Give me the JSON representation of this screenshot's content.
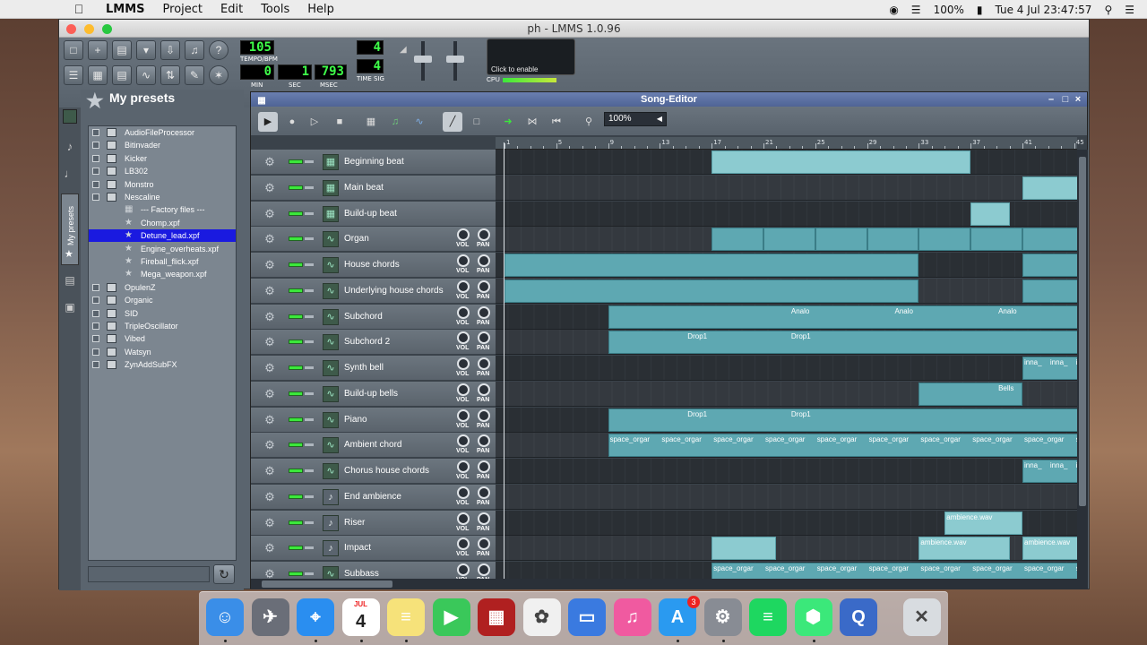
{
  "menubar": {
    "apple": "",
    "app_name": "LMMS",
    "items": [
      "Project",
      "Edit",
      "Tools",
      "Help"
    ],
    "battery": "100%",
    "datetime": "Tue 4 Jul  23:47:57"
  },
  "window": {
    "title": "ph - LMMS 1.0.96"
  },
  "transport": {
    "tempo": "105",
    "tempo_label": "TEMPO/BPM",
    "min": "0",
    "sec": "1",
    "msec": "793",
    "min_label": "MIN",
    "sec_label": "SEC",
    "msec_label": "MSEC",
    "timesig_num": "4",
    "timesig_den": "4",
    "timesig_label": "TIME SIG",
    "cpu_hint": "Click to enable",
    "cpu_label": "CPU"
  },
  "sidebar": {
    "title": "My presets",
    "tab_label": "My presets",
    "tree": [
      {
        "label": "AudioFileProcessor",
        "level": 0
      },
      {
        "label": "Bitinvader",
        "level": 0
      },
      {
        "label": "Kicker",
        "level": 0
      },
      {
        "label": "LB302",
        "level": 0
      },
      {
        "label": "Monstro",
        "level": 0
      },
      {
        "label": "Nescaline",
        "level": 0
      },
      {
        "label": "--- Factory files ---",
        "level": 1
      },
      {
        "label": "Chomp.xpf",
        "level": 1
      },
      {
        "label": "Detune_lead.xpf",
        "level": 1,
        "selected": true
      },
      {
        "label": "Engine_overheats.xpf",
        "level": 1
      },
      {
        "label": "Fireball_flick.xpf",
        "level": 1
      },
      {
        "label": "Mega_weapon.xpf",
        "level": 1
      },
      {
        "label": "OpulenZ",
        "level": 0
      },
      {
        "label": "Organic",
        "level": 0
      },
      {
        "label": "SID",
        "level": 0
      },
      {
        "label": "TripleOscillator",
        "level": 0
      },
      {
        "label": "Vibed",
        "level": 0
      },
      {
        "label": "Watsyn",
        "level": 0
      },
      {
        "label": "ZynAddSubFX",
        "level": 0
      }
    ]
  },
  "song_editor": {
    "title": "Song-Editor",
    "zoom": "100%",
    "ruler_ticks": [
      "1",
      "5",
      "9",
      "13",
      "17",
      "21",
      "25",
      "29",
      "33",
      "37",
      "41",
      "45"
    ],
    "vol_label": "VOL",
    "pan_label": "PAN",
    "tracks": [
      {
        "name": "Beginning beat",
        "type": "beat",
        "patterns": [
          {
            "start": 16,
            "len": 20
          }
        ]
      },
      {
        "name": "Main beat",
        "type": "beat",
        "patterns": [
          {
            "start": 40,
            "len": 5
          }
        ]
      },
      {
        "name": "Build-up beat",
        "type": "beat",
        "patterns": [
          {
            "start": 36,
            "len": 3
          }
        ]
      },
      {
        "name": "Organ",
        "type": "inst",
        "patterns": [
          {
            "start": 16,
            "len": 4
          },
          {
            "start": 20,
            "len": 4
          },
          {
            "start": 24,
            "len": 4
          },
          {
            "start": 28,
            "len": 4
          },
          {
            "start": 32,
            "len": 4
          },
          {
            "start": 36,
            "len": 4
          },
          {
            "start": 40,
            "len": 5
          }
        ]
      },
      {
        "name": "House chords",
        "type": "inst",
        "patterns": [
          {
            "start": 0,
            "len": 32
          },
          {
            "start": 40,
            "len": 5
          }
        ]
      },
      {
        "name": "Underlying house chords",
        "type": "inst",
        "patterns": [
          {
            "start": 0,
            "len": 32
          },
          {
            "start": 40,
            "len": 5
          }
        ]
      },
      {
        "name": "Subchord",
        "type": "inst",
        "patterns": [
          {
            "start": 8,
            "len": 37
          }
        ],
        "labels": [
          {
            "at": 22,
            "text": "Analo"
          },
          {
            "at": 30,
            "text": "Analo"
          },
          {
            "at": 38,
            "text": "Analo"
          }
        ]
      },
      {
        "name": "Subchord 2",
        "type": "inst",
        "patterns": [
          {
            "start": 8,
            "len": 37
          }
        ],
        "labels": [
          {
            "at": 14,
            "text": "Drop1"
          },
          {
            "at": 22,
            "text": "Drop1"
          }
        ]
      },
      {
        "name": "Synth bell",
        "type": "inst",
        "patterns": [
          {
            "start": 40,
            "len": 5
          }
        ],
        "labels": [
          {
            "at": 40,
            "text": "inna_"
          },
          {
            "at": 42,
            "text": "inna_"
          },
          {
            "at": 44,
            "text": "inn"
          }
        ]
      },
      {
        "name": "Build-up bells",
        "type": "inst",
        "patterns": [
          {
            "start": 32,
            "len": 8
          }
        ],
        "labels": [
          {
            "at": 38,
            "text": "Bells"
          }
        ]
      },
      {
        "name": "Piano",
        "type": "inst",
        "patterns": [
          {
            "start": 8,
            "len": 37
          }
        ],
        "labels": [
          {
            "at": 14,
            "text": "Drop1"
          },
          {
            "at": 22,
            "text": "Drop1"
          }
        ]
      },
      {
        "name": "Ambient chord",
        "type": "inst",
        "patterns": [
          {
            "start": 8,
            "len": 37
          }
        ],
        "labels": [
          {
            "at": 8,
            "text": "space_orgar"
          },
          {
            "at": 12,
            "text": "space_orgar"
          },
          {
            "at": 16,
            "text": "space_orgar"
          },
          {
            "at": 20,
            "text": "space_orgar"
          },
          {
            "at": 24,
            "text": "space_orgar"
          },
          {
            "at": 28,
            "text": "space_orgar"
          },
          {
            "at": 32,
            "text": "space_orgar"
          },
          {
            "at": 36,
            "text": "space_orgar"
          },
          {
            "at": 40,
            "text": "space_orgar"
          },
          {
            "at": 44,
            "text": "spa"
          }
        ]
      },
      {
        "name": "Chorus house chords",
        "type": "inst",
        "patterns": [
          {
            "start": 40,
            "len": 5
          }
        ],
        "labels": [
          {
            "at": 40,
            "text": "inna_"
          },
          {
            "at": 42,
            "text": "inna_"
          },
          {
            "at": 44,
            "text": "inn"
          }
        ]
      },
      {
        "name": "End ambience",
        "type": "sample",
        "patterns": []
      },
      {
        "name": "Riser",
        "type": "sample",
        "patterns": [
          {
            "start": 34,
            "len": 6
          }
        ],
        "labels": [
          {
            "at": 34,
            "text": "ambience.wav"
          }
        ]
      },
      {
        "name": "Impact",
        "type": "sample",
        "patterns": [
          {
            "start": 16,
            "len": 5
          },
          {
            "start": 32,
            "len": 7
          },
          {
            "start": 40,
            "len": 5
          }
        ],
        "labels": [
          {
            "at": 32,
            "text": "ambience.wav"
          },
          {
            "at": 40,
            "text": "ambience.wav"
          }
        ]
      },
      {
        "name": "Subbass",
        "type": "inst",
        "patterns": [
          {
            "start": 16,
            "len": 29
          }
        ],
        "labels": [
          {
            "at": 16,
            "text": "space_orgar"
          },
          {
            "at": 20,
            "text": "space_orgar"
          },
          {
            "at": 24,
            "text": "space_orgar"
          },
          {
            "at": 28,
            "text": "space_orgar"
          },
          {
            "at": 32,
            "text": "space_orgar"
          },
          {
            "at": 36,
            "text": "space_orgar"
          },
          {
            "at": 40,
            "text": "space_orgar"
          },
          {
            "at": 44,
            "text": "spa"
          }
        ]
      }
    ]
  },
  "dock": {
    "calendar_month": "JUL",
    "calendar_day": "4",
    "appstore_badge": "3",
    "apps": [
      "finder-icon",
      "launchpad-icon",
      "safari-icon",
      "calendar-icon",
      "notes-icon",
      "facetime-icon",
      "photo-booth-icon",
      "photos-icon",
      "keynote-icon",
      "itunes-icon",
      "app-store-icon",
      "system-preferences-icon",
      "spotify-icon",
      "lmms-icon",
      "quicktime-icon",
      "trash-icon"
    ]
  }
}
